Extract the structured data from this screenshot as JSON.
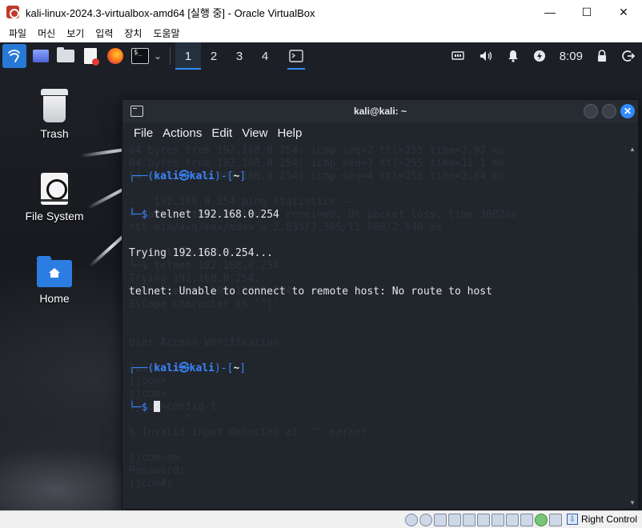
{
  "window": {
    "title": "kali-linux-2024.3-virtualbox-amd64 [실행 중] - Oracle VirtualBox",
    "minimize_glyph": "—",
    "maximize_glyph": "☐",
    "close_glyph": "✕"
  },
  "vb_menu": [
    "파일",
    "머신",
    "보기",
    "입력",
    "장치",
    "도움말"
  ],
  "panel": {
    "workspaces": [
      "1",
      "2",
      "3",
      "4"
    ],
    "active_workspace": "1",
    "time": "8:09",
    "terminal_glyph": "$_"
  },
  "desktop": {
    "icons": [
      {
        "label": "Trash",
        "icon": "trash-icon"
      },
      {
        "label": "File System",
        "icon": "drive-icon"
      },
      {
        "label": "Home",
        "icon": "home-folder-icon"
      }
    ]
  },
  "terminal": {
    "title": "kali@kali: ~",
    "menu": [
      "File",
      "Actions",
      "Edit",
      "View",
      "Help"
    ],
    "prompt": {
      "open": "┌──(",
      "user": "kali",
      "at": "㉿",
      "host": "kali",
      "mid": ")-[",
      "dir": "~",
      "close": "]",
      "second": "└─$ "
    },
    "command": "telnet 192.168.0.254",
    "output": [
      "Trying 192.168.0.254...",
      "telnet: Unable to connect to remote host: No route to host"
    ],
    "ghost_lines": [
      "64 bytes from 192.168.0.254: icmp_seq=2 ttl=255 time=7.97 ms",
      "64 bytes from 192.168.0.254: icmp_seq=3 ttl=255 time=11.1 ms",
      "64 bytes from 192.168.0.254: icmp_seq=4 ttl=255 time=2.84 ms",
      "",
      "--- 192.168.0.254 ping statistics ---",
      "4 packets transmitted, 4 received, 0% packet loss, time 3002ms",
      "rtt min/avg/max/mdev = 2.835/7.385/11.068/2.940 ms",
      "",
      "┌──(kali㉿kali)-[~]",
      "└─$ telnet 192.168.0.254",
      "Trying 192.168.0.254...",
      "Connected to 192.168.0.254.",
      "Escape character is '^]'.",
      "",
      "",
      "User Access Verification",
      "",
      "Password:",
      "jjcom>",
      "jjcom>",
      "jjcom>config t",
      "         ^",
      "% Invalid input detected at '^' marker.",
      "",
      "jjcom>en",
      "Password:",
      "jjcom#▯"
    ]
  },
  "status_bar": {
    "host_key": "Right Control",
    "host_key_glyph": "⇩"
  },
  "colors": {
    "accent_blue": "#2f8cff",
    "prompt_blue": "#3a86ff",
    "terminal_bg": "#21252c"
  }
}
